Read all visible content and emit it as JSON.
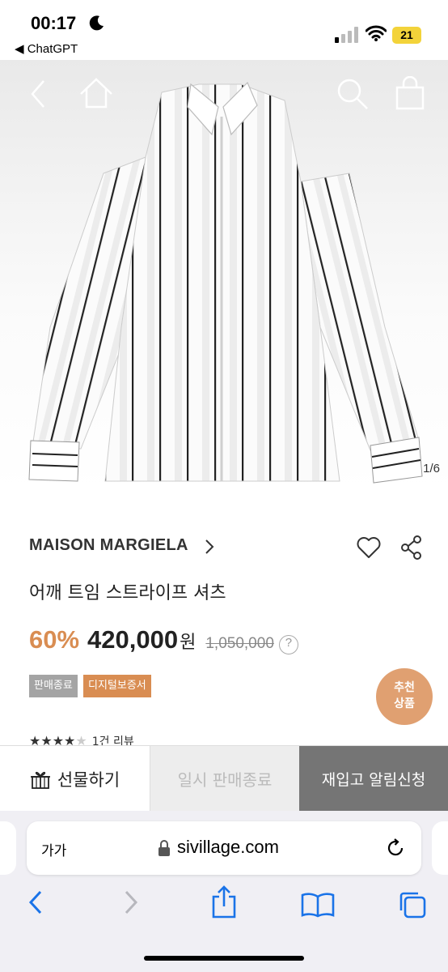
{
  "status_bar": {
    "time": "00:17",
    "back_app": "◀ ChatGPT",
    "battery": "21"
  },
  "header": {
    "icons": [
      "back-arrow-icon",
      "home-icon",
      "search-icon",
      "shopping-bag-icon"
    ]
  },
  "gallery": {
    "counter": "1/6"
  },
  "product": {
    "brand": "MAISON MARGIELA",
    "name": "어깨 트임 스트라이프 셔츠",
    "discount": "60%",
    "price": "420,000",
    "currency": "원",
    "original_price": "1,050,000",
    "help_mark": "?",
    "tags": [
      "판매종료",
      "디지털보증서"
    ],
    "recommend_line1": "추천",
    "recommend_line2": "상품",
    "rating_stars": 4,
    "review_text": "1건 리뷰"
  },
  "actions": {
    "gift": "선물하기",
    "sold_out": "일시 판매종료",
    "restock": "재입고 알림신청"
  },
  "safari": {
    "text_size": "가가",
    "domain": "sivillage.com"
  },
  "colors": {
    "accent": "#d98d52",
    "sold_tag": "#a4a4a4",
    "restock_button": "#757575",
    "recommend_badge": "#e0a071"
  }
}
